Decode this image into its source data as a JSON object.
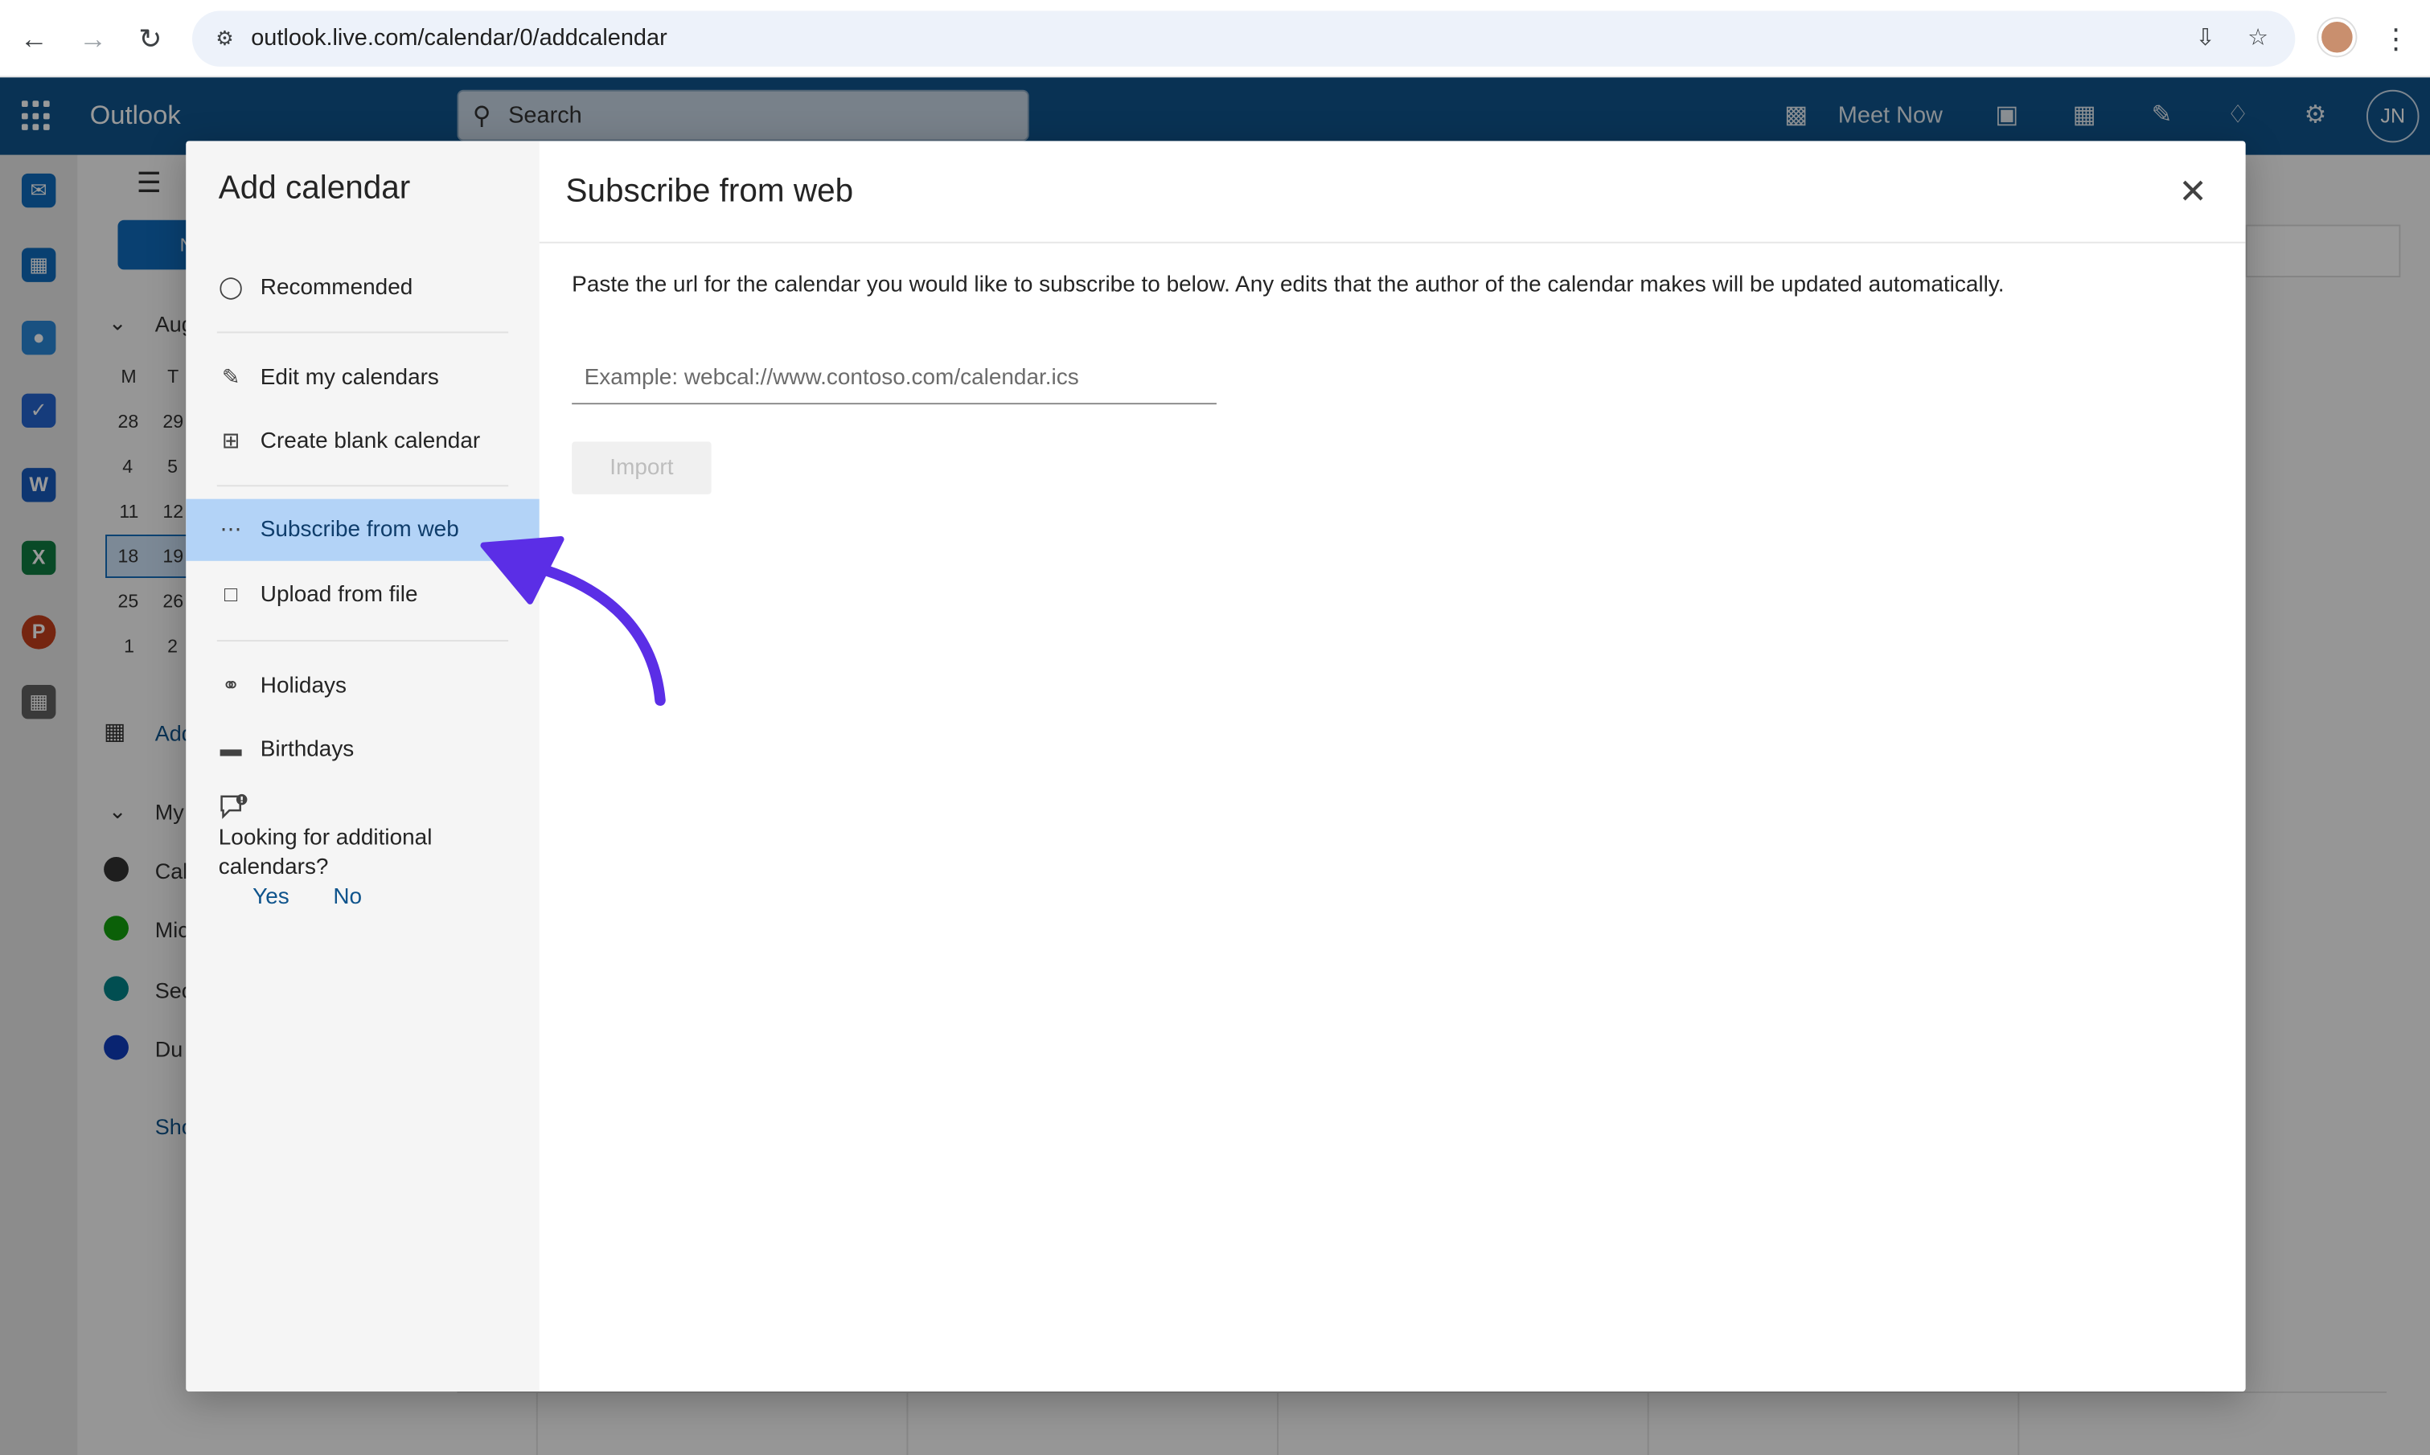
{
  "browser": {
    "url": "outlook.live.com/calendar/0/addcalendar"
  },
  "header": {
    "app_name": "Outlook",
    "search_placeholder": "Search",
    "meet_now": "Meet Now",
    "avatar_initials": "JN"
  },
  "background": {
    "month_label": "Aug",
    "weekdays": [
      "M",
      "T"
    ],
    "weeks": [
      [
        "28",
        "29"
      ],
      [
        "4",
        "5"
      ],
      [
        "11",
        "12"
      ],
      [
        "18",
        "19"
      ],
      [
        "25",
        "26"
      ],
      [
        "1",
        "2"
      ]
    ],
    "add_label": "Add",
    "my_label": "My",
    "calendars": [
      "Cal",
      "Mic",
      "Sec",
      "Du"
    ],
    "show_label": "Sho",
    "new_label": "N"
  },
  "dialog": {
    "title": "Add calendar",
    "nav": [
      {
        "label": "Recommended",
        "icon": "lightbulb-icon"
      },
      {
        "label": "Edit my calendars",
        "icon": "edit-calendar-icon"
      },
      {
        "label": "Create blank calendar",
        "icon": "add-calendar-icon"
      },
      {
        "label": "Subscribe from web",
        "icon": "web-subscribe-icon"
      },
      {
        "label": "Upload from file",
        "icon": "file-upload-icon"
      },
      {
        "label": "Holidays",
        "icon": "globe-icon"
      },
      {
        "label": "Birthdays",
        "icon": "cake-icon"
      }
    ],
    "feedback": {
      "text": "Looking for additional calendars?",
      "yes": "Yes",
      "no": "No"
    },
    "panel": {
      "title": "Subscribe from web",
      "description": "Paste the url for the calendar you would like to subscribe to below. Any edits that the author of the calendar makes will be updated automatically.",
      "input_placeholder": "Example: webcal://www.contoso.com/calendar.ics",
      "input_value": "",
      "import_label": "Import"
    }
  },
  "colors": {
    "outlook_blue": "#0f548c",
    "active_nav": "#b3d3f7",
    "annotation_arrow": "#5b2ee6"
  }
}
